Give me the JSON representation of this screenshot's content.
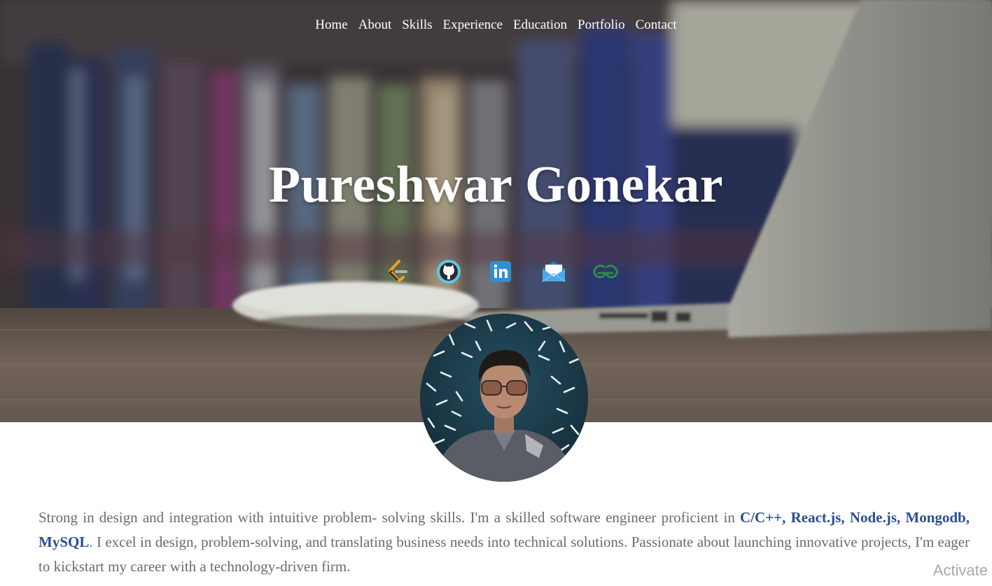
{
  "nav": {
    "items": [
      {
        "label": "Home"
      },
      {
        "label": "About"
      },
      {
        "label": "Skills"
      },
      {
        "label": "Experience"
      },
      {
        "label": "Education"
      },
      {
        "label": "Portfolio"
      },
      {
        "label": "Contact"
      }
    ]
  },
  "hero": {
    "name": "Pureshwar Gonekar"
  },
  "social": {
    "icons": [
      {
        "icon": "leetcode-icon",
        "color": "#f0a020"
      },
      {
        "icon": "github-icon",
        "color": "#5ec8e8"
      },
      {
        "icon": "linkedin-icon",
        "color": "#2d8fd5"
      },
      {
        "icon": "email-icon",
        "color": "#4aa8e8"
      },
      {
        "icon": "geeksforgeeks-icon",
        "color": "#2f8d46"
      }
    ]
  },
  "about": {
    "intro": "Strong in design and integration with intuitive problem- solving skills. I'm a skilled software engineer proficient in ",
    "skills": "C/C++, React.js, Node.js, Mongodb, MySQL",
    "rest": ". I excel in design, problem-solving, and translating business needs into technical solutions. Passionate about launching innovative projects, I'm eager to kickstart my career with a technology-driven firm.",
    "highlight_color": "#2a4d8f"
  },
  "watermark": {
    "text": "Activate"
  }
}
